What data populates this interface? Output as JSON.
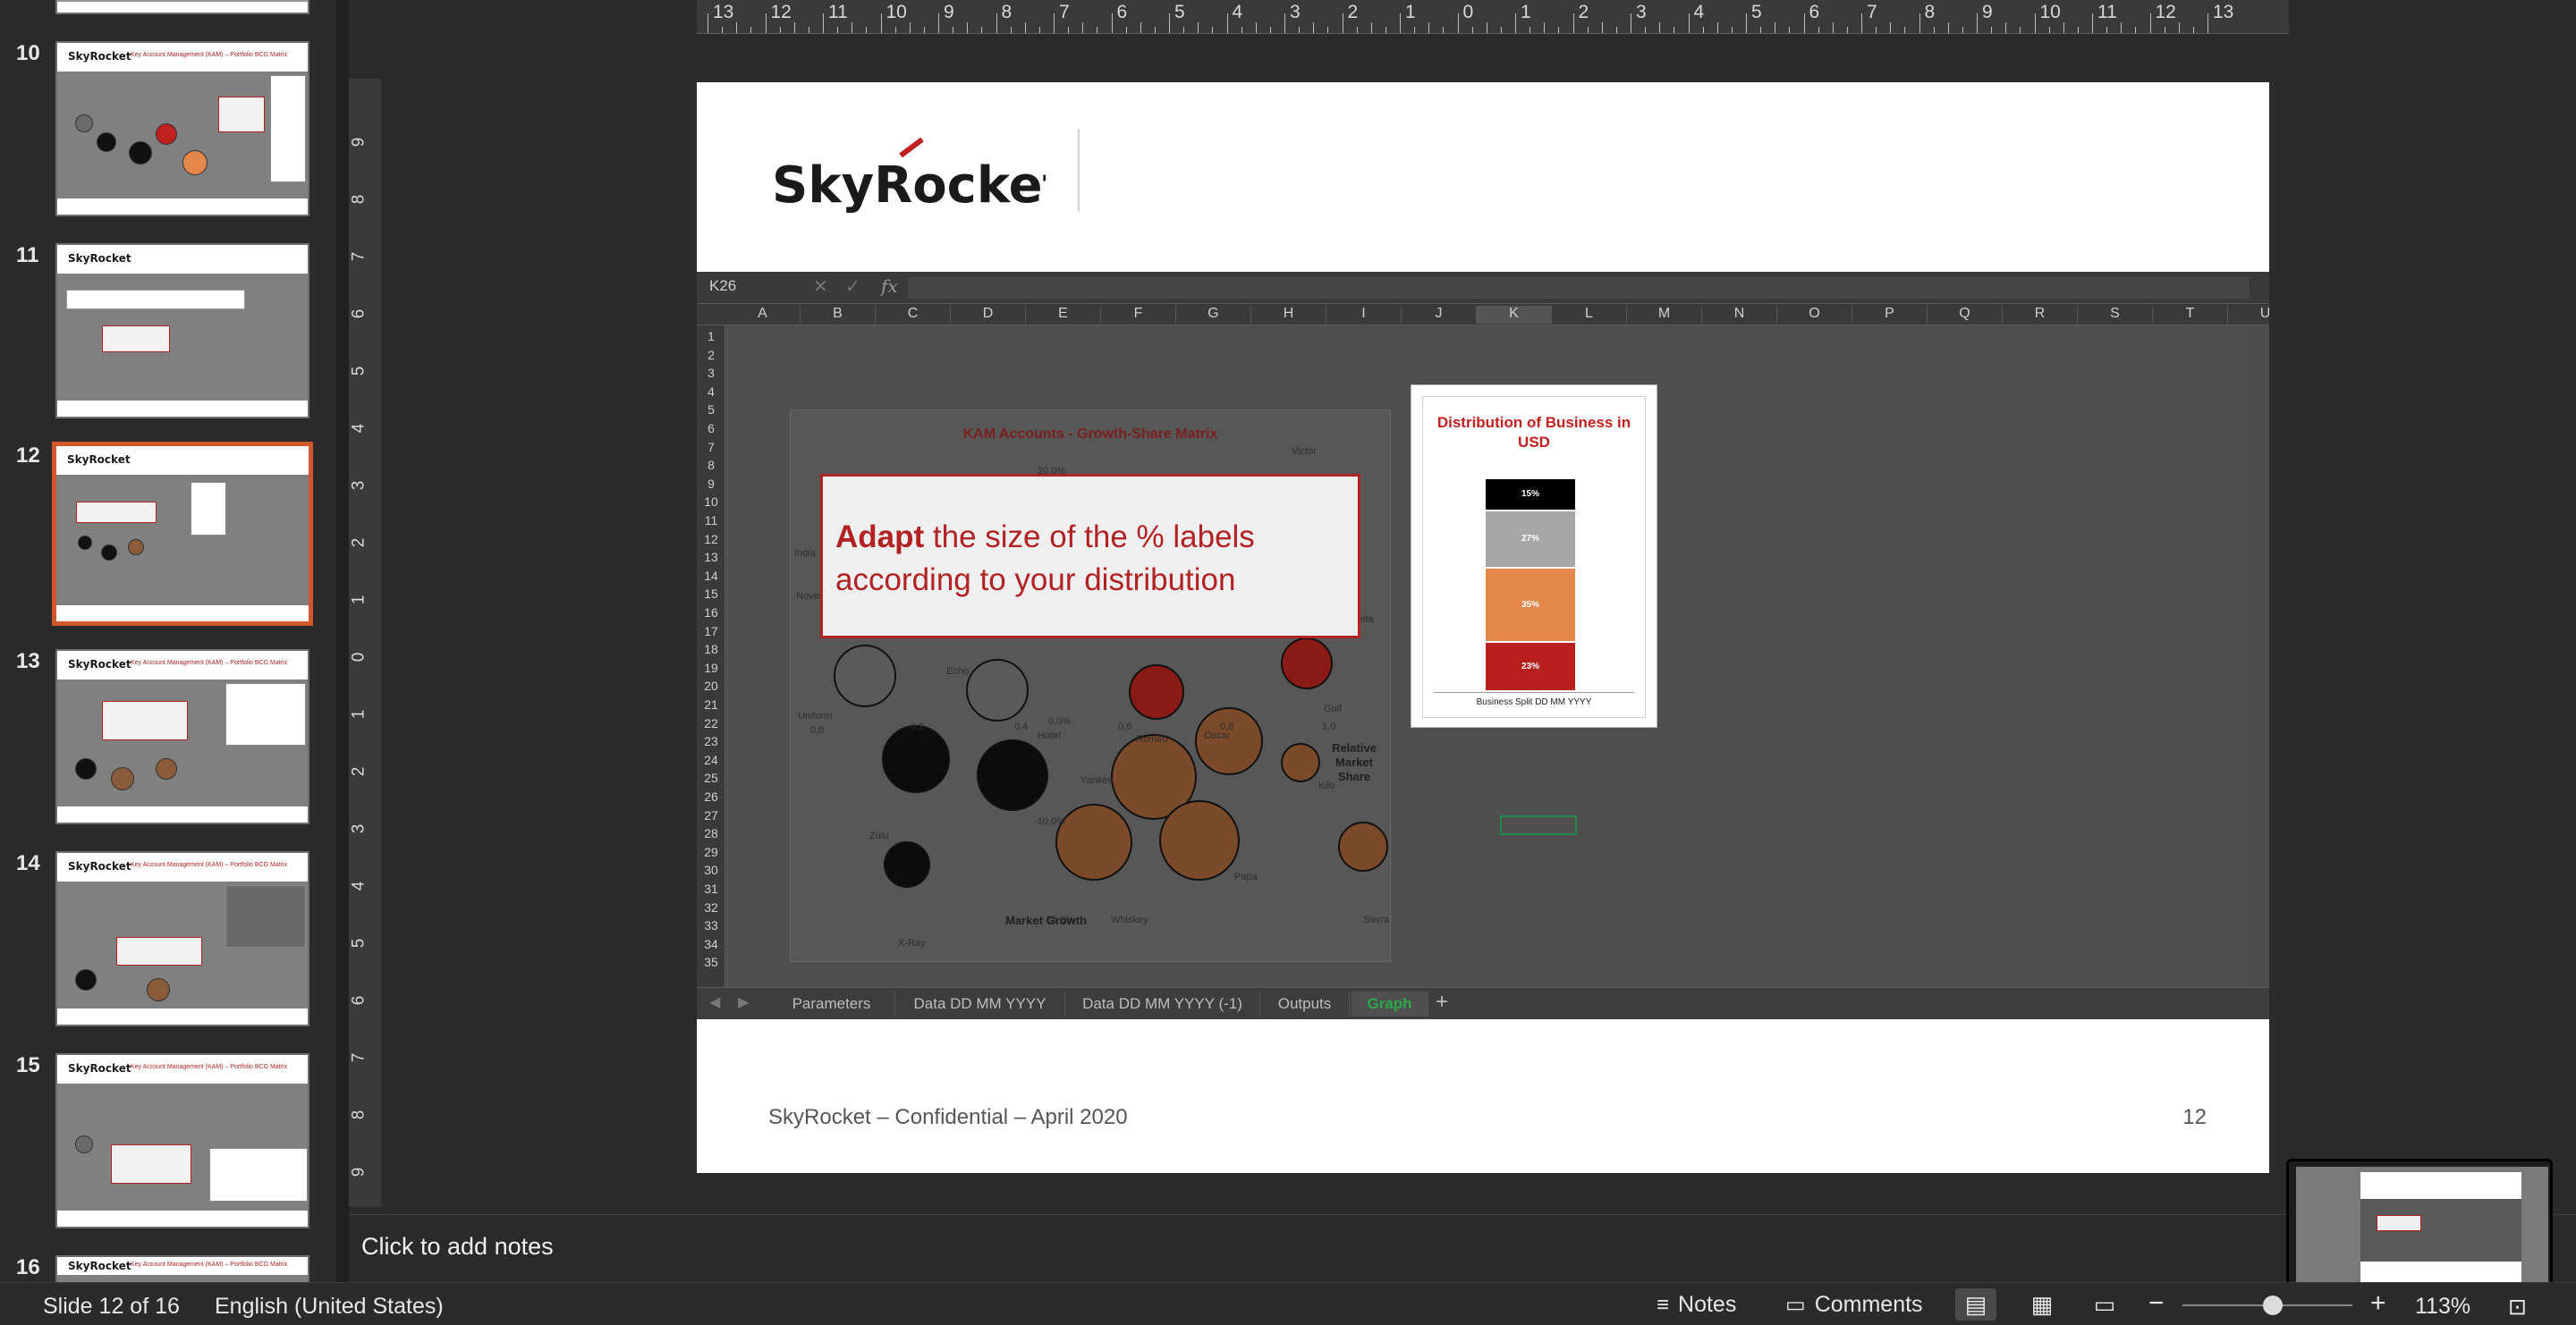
{
  "thumbnails": [
    {
      "number": "10",
      "logo": "SkyRocket",
      "title": "Key Account Management (KAM) – Portfolio BCG Matrix"
    },
    {
      "number": "11",
      "logo": "SkyRocket",
      "title": ""
    },
    {
      "number": "12",
      "logo": "SkyRocket",
      "title": "",
      "active": true
    },
    {
      "number": "13",
      "logo": "SkyRocket",
      "title": "Key Account Management (KAM) – Portfolio BCG Matrix"
    },
    {
      "number": "14",
      "logo": "SkyRocket",
      "title": "Key Account Management (KAM) – Portfolio BCG Matrix"
    },
    {
      "number": "15",
      "logo": "SkyRocket",
      "title": "Key Account Management (KAM) – Portfolio BCG Matrix"
    },
    {
      "number": "16",
      "logo": "SkyRocket",
      "title": "Key Account Management (KAM) – Portfolio BCG Matrix"
    }
  ],
  "ruler": {
    "top_labels": [
      "13",
      "12",
      "11",
      "10",
      "9",
      "8",
      "7",
      "6",
      "5",
      "4",
      "3",
      "2",
      "1",
      "0",
      "1",
      "2",
      "3",
      "4",
      "5",
      "6",
      "7",
      "8",
      "9",
      "10",
      "11",
      "12",
      "13"
    ],
    "left_labels": [
      "9",
      "8",
      "7",
      "6",
      "5",
      "4",
      "3",
      "2",
      "1",
      "0",
      "1",
      "2",
      "3",
      "4",
      "5",
      "6",
      "7",
      "8",
      "9"
    ]
  },
  "slide": {
    "logo_text": "SkyRocket",
    "footer": "SkyRocket – Confidential – April 2020",
    "number": "12"
  },
  "excel": {
    "name_box": "K26",
    "fx": "fx",
    "columns": [
      "A",
      "B",
      "C",
      "D",
      "E",
      "F",
      "G",
      "H",
      "I",
      "J",
      "K",
      "L",
      "M",
      "N",
      "O",
      "P",
      "Q",
      "R",
      "S",
      "T",
      "U"
    ],
    "selected_column": "K",
    "rows": [
      "1",
      "2",
      "3",
      "4",
      "5",
      "6",
      "7",
      "8",
      "9",
      "10",
      "11",
      "12",
      "13",
      "14",
      "15",
      "16",
      "17",
      "18",
      "19",
      "20",
      "21",
      "22",
      "23",
      "24",
      "25",
      "26",
      "27",
      "28",
      "29",
      "30",
      "31",
      "32",
      "33",
      "34",
      "35"
    ],
    "sheet_tabs": [
      "Parameters",
      "Data DD MM YYYY",
      "Data DD MM YYYY (-1)",
      "Outputs",
      "Graph"
    ],
    "active_tab": "Graph",
    "add_tab": "+"
  },
  "kam_chart": {
    "title": "KAM Accounts - Growth-Share Matrix",
    "x_label": "Market Growth",
    "y_label": "Relative Market Share",
    "ticks": [
      "0,0",
      "0,2",
      "0,4",
      "0,6",
      "0,8",
      "1,0",
      "20,0%",
      "0,0%",
      "-10,0%",
      "-15,0%"
    ],
    "bubble_labels": [
      "Victor",
      "India",
      "November",
      "Echo",
      "Uniform",
      "Zulu",
      "Hotel",
      "Romeo",
      "Oscar",
      "Yankee",
      "Kilo",
      "Golf",
      "Delta",
      "Whiskey",
      "Papa",
      "Sierra",
      "X-Ray"
    ]
  },
  "callout": {
    "bold": "Adapt",
    "rest": " the size of the % labels according to your distribution"
  },
  "chart_data": {
    "type": "bar",
    "title": "Distribution of Business in USD",
    "xlabel": "Business Split DD MM YYYY",
    "ylabel": "",
    "categories": [
      "Business Split DD MM YYYY"
    ],
    "series": [
      {
        "values": [
          23
        ],
        "color": "#b8201d"
      },
      {
        "values": [
          35
        ],
        "color": "#e3884a"
      },
      {
        "values": [
          27
        ],
        "color": "#a7a7a7"
      },
      {
        "values": [
          15
        ],
        "color": "#000000"
      }
    ],
    "labels": [
      "23%",
      "35%",
      "27%",
      "15%"
    ],
    "stacked": true,
    "ylim": [
      0,
      100
    ]
  },
  "notes": {
    "placeholder": "Click to add notes"
  },
  "status": {
    "slide_info": "Slide 12 of 16",
    "language": "English (United States)",
    "notes_label": "Notes",
    "comments_label": "Comments",
    "zoom": "113%"
  }
}
